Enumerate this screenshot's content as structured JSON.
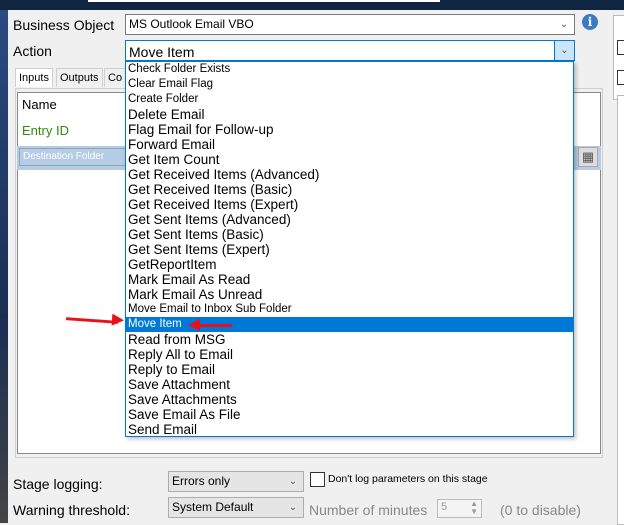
{
  "business_object": {
    "label": "Business Object",
    "value": "MS Outlook Email VBO"
  },
  "action": {
    "label": "Action",
    "value": "Move Item"
  },
  "tabs": [
    "Inputs",
    "Outputs",
    "Co"
  ],
  "grid": {
    "header": "Name",
    "rows": [
      "Entry ID",
      "Destination Folder"
    ]
  },
  "dropdown": {
    "items": [
      "Check Folder Exists",
      "Clear Email Flag",
      "Create Folder",
      "Delete Email",
      "Flag Email for Follow-up",
      "Forward Email",
      "Get Item Count",
      "Get Received Items (Advanced)",
      "Get Received Items (Basic)",
      "Get Received Items (Expert)",
      "Get Sent Items (Advanced)",
      "Get Sent Items (Basic)",
      "Get Sent Items (Expert)",
      "GetReportItem",
      "Mark Email As Read",
      "Mark Email As Unread",
      "Move Email to Inbox Sub Folder",
      "Move Item",
      "Read from MSG",
      "Reply All to Email",
      "Reply to Email",
      "Save Attachment",
      "Save Attachments",
      "Save Email As File",
      "Send Email"
    ],
    "selected": "Move Item"
  },
  "stage_logging": {
    "label": "Stage logging:",
    "value": "Errors only",
    "checkbox_label": "Don't log parameters on this stage"
  },
  "warning": {
    "label": "Warning threshold:",
    "value": "System Default",
    "minutes_label": "Number of minutes",
    "minutes": "5",
    "hint": "(0 to disable)"
  },
  "colors": {
    "accent": "#0078d7",
    "arrow": "#e8101a",
    "entry_id": "#2e8b0e"
  }
}
